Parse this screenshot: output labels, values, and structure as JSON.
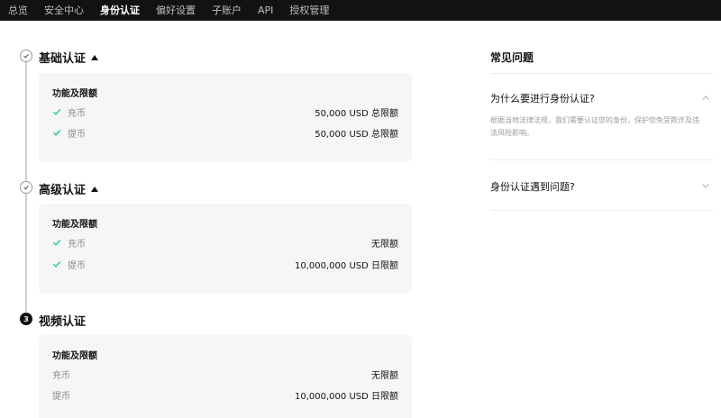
{
  "nav": {
    "items": [
      {
        "label": "总览",
        "active": false
      },
      {
        "label": "安全中心",
        "active": false
      },
      {
        "label": "身份认证",
        "active": true
      },
      {
        "label": "偏好设置",
        "active": false
      },
      {
        "label": "子账户",
        "active": false
      },
      {
        "label": "API",
        "active": false
      },
      {
        "label": "授权管理",
        "active": false
      }
    ]
  },
  "steps": [
    {
      "title": "基础认证",
      "status": "done",
      "card_title": "功能及限额",
      "rows": [
        {
          "label": "充币",
          "value": "50,000 USD 总限额"
        },
        {
          "label": "提币",
          "value": "50,000 USD 总限额"
        }
      ]
    },
    {
      "title": "高级认证",
      "status": "done",
      "card_title": "功能及限额",
      "rows": [
        {
          "label": "充币",
          "value": "无限额"
        },
        {
          "label": "提币",
          "value": "10,000,000 USD 日限额"
        }
      ]
    },
    {
      "title": "视频认证",
      "status": "pending",
      "number": "3",
      "card_title": "功能及限额",
      "rows": [
        {
          "label": "充币",
          "value": "无限额"
        },
        {
          "label": "提币",
          "value": "10,000,000 USD 日限额"
        }
      ]
    }
  ],
  "faq": {
    "heading": "常见问题",
    "items": [
      {
        "question": "为什么要进行身份认证?",
        "answer": "根据当地法律法规，我们需要认证您的身份，保护您免受欺诈及违法风险影响。",
        "expanded": true
      },
      {
        "question": "身份认证遇到问题?",
        "expanded": false
      }
    ]
  },
  "colors": {
    "check": "#2ec7a6",
    "nav_bg": "#121212",
    "card_bg": "#f6f6f6"
  }
}
